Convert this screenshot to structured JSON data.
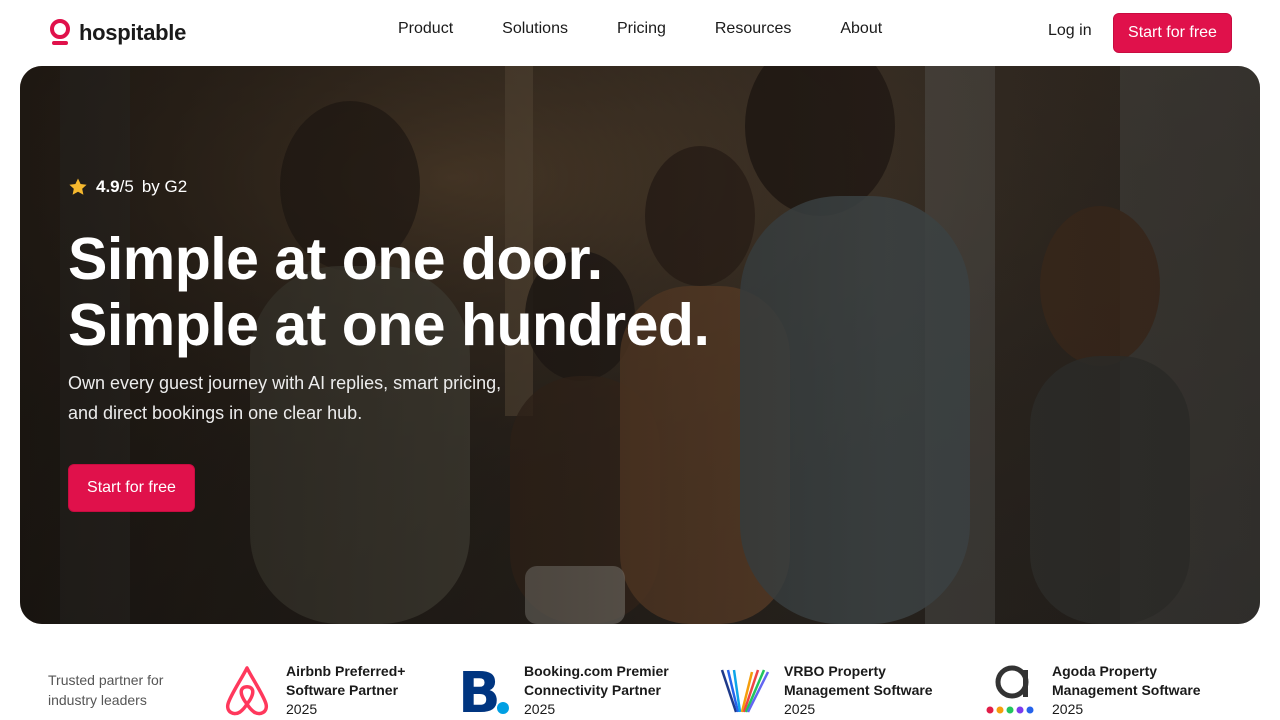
{
  "brand": {
    "name": "hospitable",
    "accent": "#e0114b"
  },
  "nav": {
    "items": [
      "Product",
      "Solutions",
      "Pricing",
      "Resources",
      "About"
    ]
  },
  "header": {
    "login": "Log in",
    "cta": "Start for free"
  },
  "hero": {
    "rating_score": "4.9",
    "rating_scale": "/5",
    "rating_source": "by G2",
    "headline_line1": "Simple at one door.",
    "headline_line2": "Simple at one hundred.",
    "subtext": "Own every guest journey with AI replies, smart pricing, and direct bookings in one clear hub.",
    "cta": "Start for free"
  },
  "partners": {
    "label": "Trusted partner for industry leaders",
    "items": [
      {
        "logo": "airbnb-logo",
        "title_line1": "Airbnb Preferred+",
        "title_line2": "Software Partner",
        "year": "2025"
      },
      {
        "logo": "booking-logo",
        "title_line1": "Booking.com Premier",
        "title_line2": "Connectivity Partner",
        "year": "2025"
      },
      {
        "logo": "vrbo-logo",
        "title_line1": "VRBO Property",
        "title_line2": "Management Software",
        "year": "2025"
      },
      {
        "logo": "agoda-logo",
        "title_line1": "Agoda Property",
        "title_line2": "Management Software",
        "year": "2025"
      }
    ]
  }
}
